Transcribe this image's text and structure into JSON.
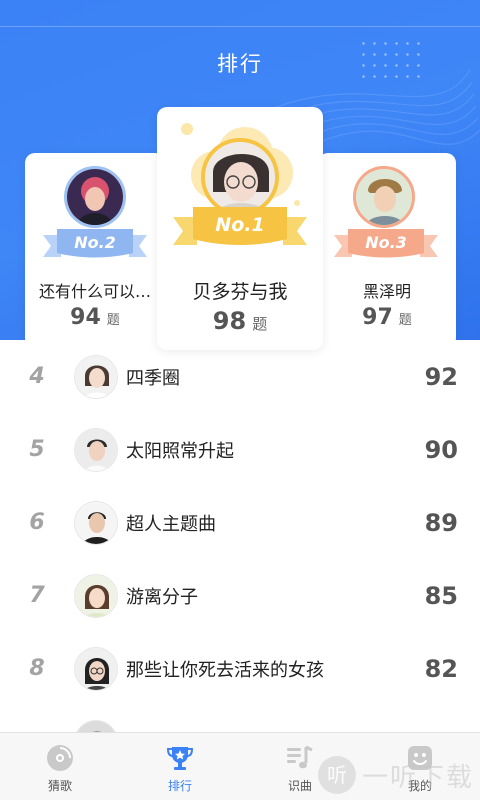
{
  "header": {
    "title": "排行"
  },
  "podium": {
    "unit": "题",
    "first": {
      "badge": "No.1",
      "name": "贝多芬与我",
      "score": "98"
    },
    "second": {
      "badge": "No.2",
      "name": "还有什么可以…",
      "score": "94"
    },
    "third": {
      "badge": "No.3",
      "name": "黑泽明",
      "score": "97"
    }
  },
  "ranking": [
    {
      "rank": "4",
      "name": "四季圈",
      "score": "92"
    },
    {
      "rank": "5",
      "name": "太阳照常升起",
      "score": "90"
    },
    {
      "rank": "6",
      "name": "超人主题曲",
      "score": "89"
    },
    {
      "rank": "7",
      "name": "游离分子",
      "score": "85"
    },
    {
      "rank": "8",
      "name": "那些让你死去活来的女孩",
      "score": "82"
    }
  ],
  "tabs": [
    {
      "label": "猜歌",
      "icon": "disc-icon"
    },
    {
      "label": "排行",
      "icon": "trophy-icon"
    },
    {
      "label": "识曲",
      "icon": "music-list-icon"
    },
    {
      "label": "我的",
      "icon": "smile-face-icon"
    }
  ],
  "watermark": {
    "glyph": "听",
    "text": "一听下载"
  },
  "colors": {
    "primary": "#3b82f6",
    "gold": "#f6c343",
    "silver": "#9ec2f4",
    "bronze": "#f5a88a"
  }
}
